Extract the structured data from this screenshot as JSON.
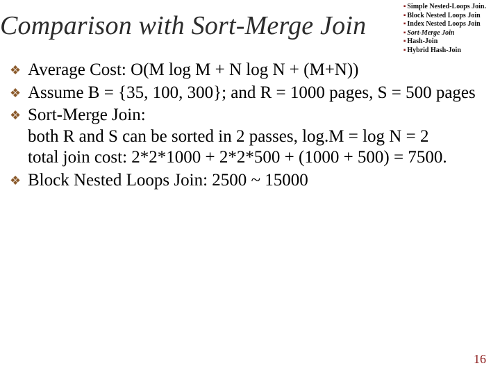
{
  "title": "Comparison with Sort-Merge Join",
  "toc": {
    "items": [
      {
        "label": "Simple Nested-Loops Join.",
        "cls": "norm"
      },
      {
        "label": "Block Nested Loops Join",
        "cls": "norm"
      },
      {
        "label": "Index Nested Loops Join",
        "cls": "norm"
      },
      {
        "label": "Sort-Merge Join",
        "cls": "em"
      },
      {
        "label": "Hash-Join",
        "cls": "norm"
      },
      {
        "label": "Hybrid Hash-Join",
        "cls": "norm"
      }
    ]
  },
  "bullets": [
    "Average Cost:   O(M log M + N log N + (M+N))",
    "Assume B = {35, 100, 300};  and                               R = 1000 pages, S = 500 pages",
    "Sort-Merge Join:\nboth R and S can be sorted in 2 passes,               log.M = log N = 2\ntotal join cost: 2*2*1000 + 2*2*500 + (1000 + 500) = 7500.",
    "Block Nested Loops Join:  2500 ~ 15000"
  ],
  "page_number": "16",
  "bullet_glyph": "❖",
  "toc_glyph": "▪"
}
